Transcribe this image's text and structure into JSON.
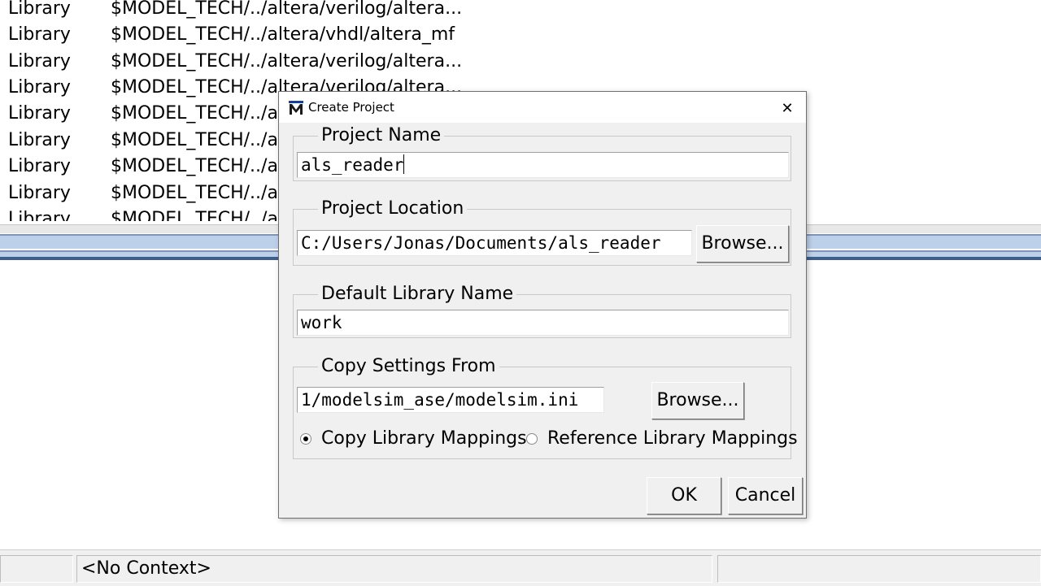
{
  "library_list": {
    "rows": [
      {
        "type": "Library",
        "path": "$MODEL_TECH/../altera/verilog/altera..."
      },
      {
        "type": "Library",
        "path": "$MODEL_TECH/../altera/vhdl/altera_mf"
      },
      {
        "type": "Library",
        "path": "$MODEL_TECH/../altera/verilog/altera..."
      },
      {
        "type": "Library",
        "path": "$MODEL_TECH/../altera/verilog/altera..."
      },
      {
        "type": "Library",
        "path": "$MODEL_TECH/../al"
      },
      {
        "type": "Library",
        "path": "$MODEL_TECH/../al"
      },
      {
        "type": "Library",
        "path": "$MODEL_TECH/../al"
      },
      {
        "type": "Library",
        "path": "$MODEL_TECH/../al"
      },
      {
        "type": "Library",
        "path": "$MODEL_TECH/../al"
      }
    ]
  },
  "status_bar": {
    "context": "<No Context>"
  },
  "dialog": {
    "title": "Create Project",
    "close_glyph": "✕",
    "project_name": {
      "label": "Project Name",
      "value": "als_reader"
    },
    "project_location": {
      "label": "Project Location",
      "value": "C:/Users/Jonas/Documents/als_reader",
      "browse_label": "Browse..."
    },
    "default_library": {
      "label": "Default Library Name",
      "value": "work"
    },
    "copy_settings": {
      "label": "Copy Settings From",
      "value": "1/modelsim_ase/modelsim.ini",
      "browse_label": "Browse...",
      "option_copy": "Copy Library Mappings",
      "option_reference": "Reference Library Mappings",
      "selected": "copy"
    },
    "ok_label": "OK",
    "cancel_label": "Cancel"
  },
  "colors": {
    "accent_blue": "#1c3f8c",
    "dialog_bg": "#f0f0f0"
  }
}
